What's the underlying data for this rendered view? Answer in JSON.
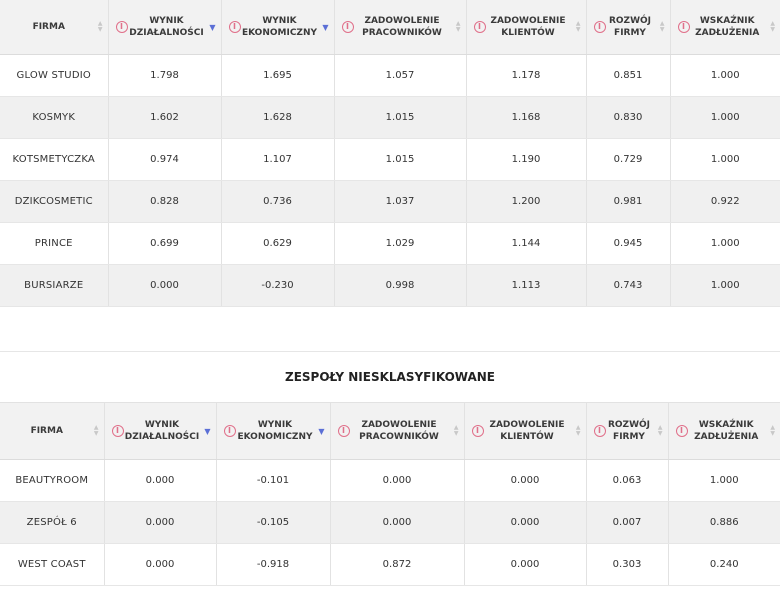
{
  "colors": {
    "info_icon": "#e0708a",
    "sort_active": "#5b6fd6",
    "header_bg": "#f2f2f2",
    "row_alt_bg": "#f0f0f0"
  },
  "columns": {
    "firma": "FIRMA",
    "wynik_dzialalnosci": "WYNIK DZIAŁALNOŚCI",
    "wynik_ekonomiczny": "WYNIK EKONOMICZNY",
    "zadowolenie_pracownikow": "ZADOWOLENIE PRACOWNIKÓW",
    "zadowolenie_klientow": "ZADOWOLENIE KLIENTÓW",
    "rozwoj_firmy": "ROZWÓJ FIRMY",
    "wskaznik_zadluzenia": "WSKAŹNIK ZADŁUŻENIA"
  },
  "icons": {
    "info": "i",
    "sort_both": "sort-both-icon",
    "sort_desc": "▼"
  },
  "table1": {
    "rows": [
      {
        "firma": "GLOW STUDIO",
        "v1": "1.798",
        "v2": "1.695",
        "v3": "1.057",
        "v4": "1.178",
        "v5": "0.851",
        "v6": "1.000"
      },
      {
        "firma": "KOSMYK",
        "v1": "1.602",
        "v2": "1.628",
        "v3": "1.015",
        "v4": "1.168",
        "v5": "0.830",
        "v6": "1.000"
      },
      {
        "firma": "KOTSMETYCZKA",
        "v1": "0.974",
        "v2": "1.107",
        "v3": "1.015",
        "v4": "1.190",
        "v5": "0.729",
        "v6": "1.000"
      },
      {
        "firma": "DZIKCOSMETIC",
        "v1": "0.828",
        "v2": "0.736",
        "v3": "1.037",
        "v4": "1.200",
        "v5": "0.981",
        "v6": "0.922"
      },
      {
        "firma": "PRINCE",
        "v1": "0.699",
        "v2": "0.629",
        "v3": "1.029",
        "v4": "1.144",
        "v5": "0.945",
        "v6": "1.000"
      },
      {
        "firma": "BURSIARZE",
        "v1": "0.000",
        "v2": "-0.230",
        "v3": "0.998",
        "v4": "1.113",
        "v5": "0.743",
        "v6": "1.000"
      }
    ]
  },
  "section2_title": "ZESPOŁY NIESKLASYFIKOWANE",
  "table2": {
    "rows": [
      {
        "firma": "BEAUTYROOM",
        "v1": "0.000",
        "v2": "-0.101",
        "v3": "0.000",
        "v4": "0.000",
        "v5": "0.063",
        "v6": "1.000"
      },
      {
        "firma": "ZESPÓŁ 6",
        "v1": "0.000",
        "v2": "-0.105",
        "v3": "0.000",
        "v4": "0.000",
        "v5": "0.007",
        "v6": "0.886"
      },
      {
        "firma": "WEST COAST",
        "v1": "0.000",
        "v2": "-0.918",
        "v3": "0.872",
        "v4": "0.000",
        "v5": "0.303",
        "v6": "0.240"
      }
    ]
  }
}
